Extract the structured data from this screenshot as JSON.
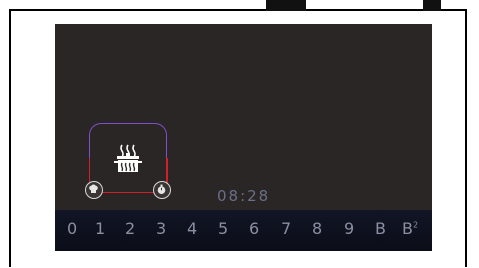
{
  "cooktop": {
    "timer": "08:28",
    "levels": [
      "0",
      "1",
      "2",
      "3",
      "4",
      "5",
      "6",
      "7",
      "8",
      "9",
      "B"
    ],
    "boost_plus": {
      "base": "B",
      "sup": "2"
    }
  },
  "icons": {
    "zone": "pot-steam-icon",
    "left": "chef-hat-icon",
    "right": "timer-icon"
  },
  "colors": {
    "screen_bg": "#2a2626",
    "card_border": "#7e4fc9",
    "active_red": "#d1202a",
    "level_text": "#8a8fa2",
    "timer_text": "#6b6f85"
  }
}
